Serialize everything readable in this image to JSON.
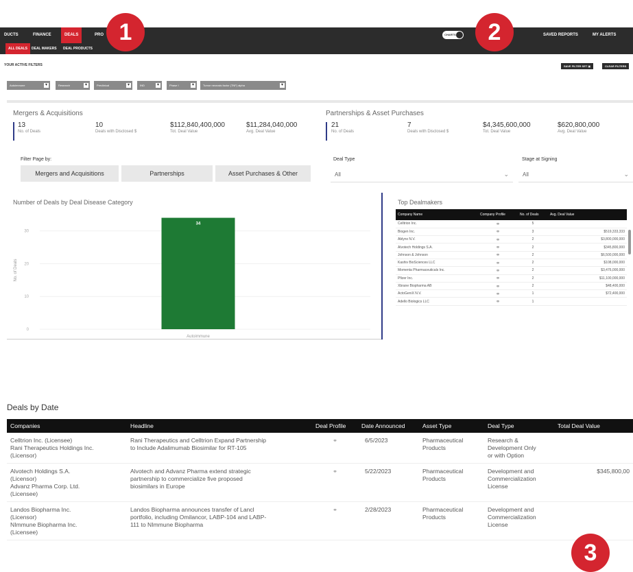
{
  "top_nav": {
    "items": [
      "DUCTS",
      "FINANCE",
      "DEALS",
      "PRO"
    ],
    "toggle": "CHARTS",
    "right": [
      "SAVED REPORTS",
      "MY ALERTS"
    ]
  },
  "sub_nav": {
    "items": [
      "ALL DEALS",
      "DEAL MAKERS",
      "DEAL PRODUCTS"
    ]
  },
  "filters": {
    "title": "YOUR ACTIVE FILTERS",
    "save_label": "SAVE FILTER SET",
    "clear_label": "CLEAR FILTERS",
    "chips": [
      "Autoimmune",
      "Research",
      "Preclinical",
      "IND",
      "Phase I",
      "Tumor necrosis factor (TNF) alpha"
    ]
  },
  "ma": {
    "title": "Mergers & Acquisitions",
    "kpis": [
      {
        "value": "13",
        "label": "No. of Deals"
      },
      {
        "value": "10",
        "label": "Deals with Disclosed $"
      },
      {
        "value": "$112,840,400,000",
        "label": "Tot. Deal Value"
      },
      {
        "value": "$11,284,040,000",
        "label": "Avg. Deal Value"
      }
    ]
  },
  "pap": {
    "title": "Partnerships & Asset Purchases",
    "kpis": [
      {
        "value": "21",
        "label": "No. of Deals"
      },
      {
        "value": "7",
        "label": "Deals with Disclosed $"
      },
      {
        "value": "$4,345,600,000",
        "label": "Tot. Deal Value"
      },
      {
        "value": "$620,800,000",
        "label": "Avg. Deal Value"
      }
    ]
  },
  "filter_page": {
    "label": "Filter Page by:",
    "buttons": [
      "Mergers and Acquisitions",
      "Partnerships",
      "Asset Purchases & Other"
    ]
  },
  "deal_type": {
    "label": "Deal Type",
    "value": "All"
  },
  "stage": {
    "label": "Stage at Signing",
    "value": "All"
  },
  "chart_data": {
    "type": "bar",
    "title": "Number of Deals by Deal Disease Category",
    "ylabel": "No. of Deals",
    "categories": [
      "Autoimmune"
    ],
    "values": [
      34
    ],
    "ylim": [
      0,
      36
    ],
    "yticks": [
      0,
      10,
      20,
      30
    ],
    "color": "#1e7a34"
  },
  "top_dealmakers": {
    "title": "Top Dealmakers",
    "columns": [
      "Company Name",
      "Company Profile",
      "No. of Deals",
      "Avg. Deal Value"
    ],
    "rows": [
      {
        "company": "Celltrion Inc.",
        "deals": "5",
        "avg": ""
      },
      {
        "company": "Biogen Inc.",
        "deals": "3",
        "avg": "$519,333,333"
      },
      {
        "company": "Ablynx N.V.",
        "deals": "2",
        "avg": "$3,800,000,000"
      },
      {
        "company": "Alvotech Holdings S.A.",
        "deals": "2",
        "avg": "$345,800,000"
      },
      {
        "company": "Johnson & Johnson",
        "deals": "2",
        "avg": "$6,500,000,000"
      },
      {
        "company": "Kashiv BioSciences LLC",
        "deals": "2",
        "avg": "$108,000,000"
      },
      {
        "company": "Momenta Pharmaceuticals Inc.",
        "deals": "2",
        "avg": "$3,476,000,000"
      },
      {
        "company": "Pfizer Inc.",
        "deals": "2",
        "avg": "$11,100,000,000"
      },
      {
        "company": "Xbrane Biopharma AB",
        "deals": "2",
        "avg": "$48,400,000"
      },
      {
        "company": "ActoGeniX N.V.",
        "deals": "1",
        "avg": "$72,400,000"
      },
      {
        "company": "Adello Biologics LLC",
        "deals": "1",
        "avg": ""
      }
    ]
  },
  "deals_by_date": {
    "title": "Deals by Date",
    "columns": [
      "Companies",
      "Headline",
      "Deal Profile",
      "Date Announced",
      "Asset Type",
      "Deal Type",
      "Total Deal Value"
    ],
    "rows": [
      {
        "companies": "Celltrion Inc. (Licensee)\nRani Therapeutics Holdings Inc.\n(Licensor)",
        "headline": "Rani Therapeutics and Celltrion Expand Partnership\nto Include Adalimumab Biosimilar for RT-105",
        "date": "6/5/2023",
        "asset": "Pharmaceutical\nProducts",
        "deal_type": "Research &\nDevelopment Only\nor with Option",
        "value": ""
      },
      {
        "companies": "Alvotech Holdings S.A.\n(Licensor)\nAdvanz Pharma Corp. Ltd.\n(Licensee)",
        "headline": "Alvotech and Advanz Pharma extend strategic\npartnership to commercialize five proposed\nbiosimilars in Europe",
        "date": "5/22/2023",
        "asset": "Pharmaceutical\nProducts",
        "deal_type": "Development and\nCommercialization\nLicense",
        "value": "$345,800,00"
      },
      {
        "companies": "Landos Biopharma Inc.\n(Licensor)\nNImmune Biopharma Inc.\n(Licensee)",
        "headline": "Landos Biopharma announces transfer of Lancl\nportfolio, including Omilancor, LABP-104 and LABP-\n111 to NImmune Biopharma",
        "date": "2/28/2023",
        "asset": "Pharmaceutical\nProducts",
        "deal_type": "Development and\nCommercialization\nLicense",
        "value": ""
      }
    ]
  },
  "badges": [
    "1",
    "2",
    "3"
  ]
}
